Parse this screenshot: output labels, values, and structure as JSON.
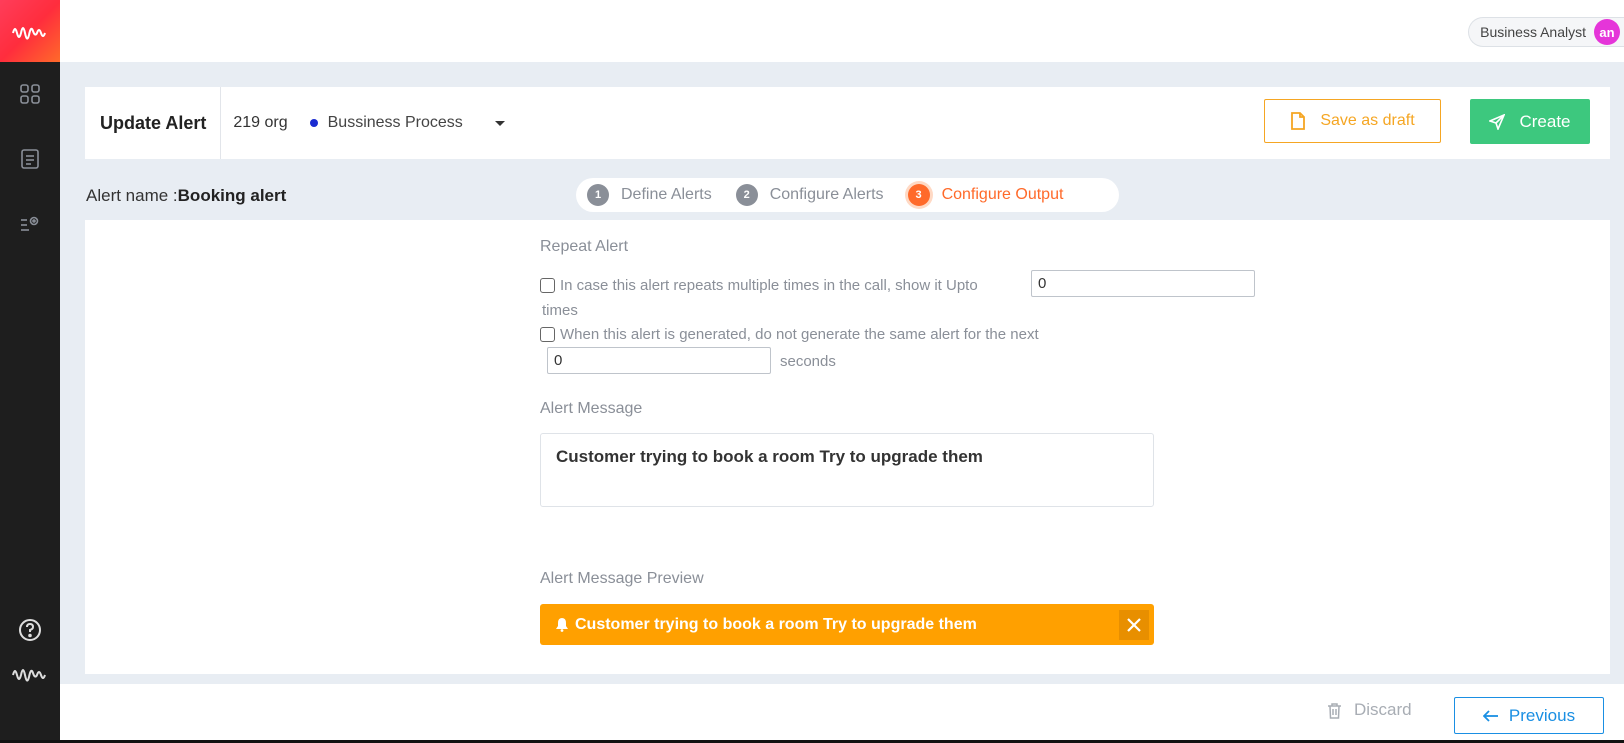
{
  "user": {
    "role": "Business Analyst",
    "initials": "an"
  },
  "header": {
    "title": "Update Alert",
    "org": "219 org",
    "process": "Bussiness Process",
    "save_draft_label": "Save as draft",
    "create_label": "Create"
  },
  "alert": {
    "name_label": "Alert name :",
    "name_value": "Booking alert"
  },
  "steps": [
    {
      "num": "1",
      "label": "Define Alerts"
    },
    {
      "num": "2",
      "label": "Configure Alerts"
    },
    {
      "num": "3",
      "label": "Configure Output"
    }
  ],
  "repeat": {
    "title": "Repeat Alert",
    "option1_text": "In case this alert repeats multiple times in the call, show it Upto",
    "option1_value": "0",
    "option1_suffix": "times",
    "option2_text": "When this alert is generated, do not generate the same alert for the next",
    "option2_value": "0",
    "option2_suffix": "seconds"
  },
  "message": {
    "title": "Alert Message",
    "text": "Customer trying to book a room Try to upgrade them"
  },
  "preview": {
    "title": "Alert Message Preview",
    "text": "Customer trying to book a room Try to upgrade them"
  },
  "footer": {
    "discard_label": "Discard",
    "previous_label": "Previous"
  },
  "colors": {
    "accent_orange": "#ff6a2a",
    "create_green": "#3dc87e",
    "draft_amber": "#f5a623",
    "preview_bg": "#ffa000",
    "link_blue": "#1a8fe3"
  }
}
